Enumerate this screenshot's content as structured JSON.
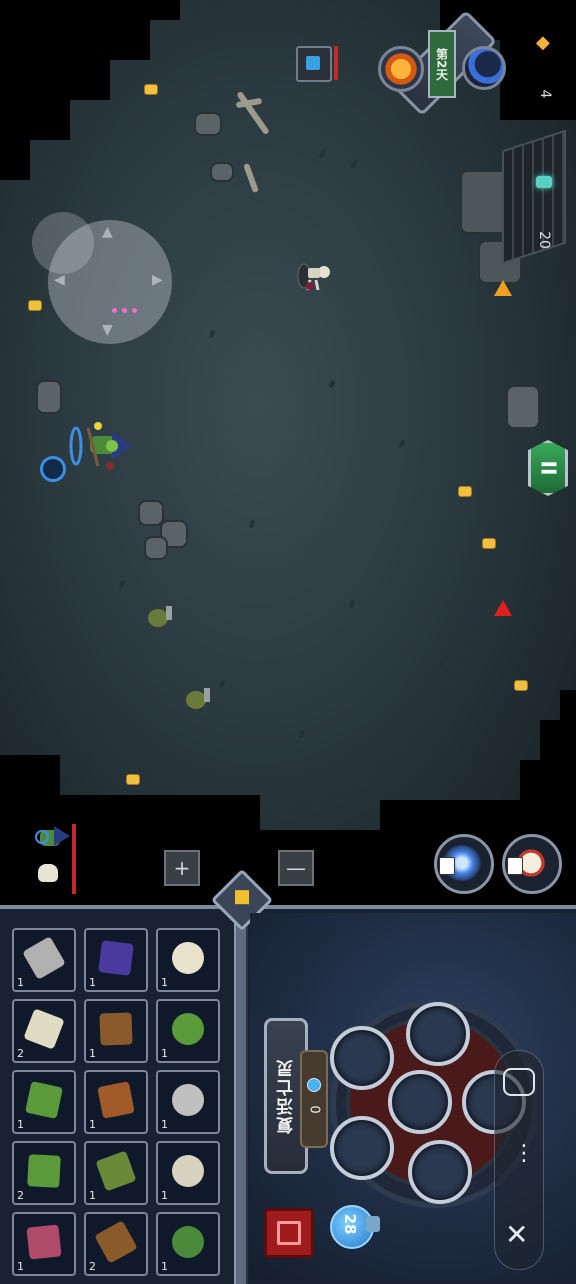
{
  "hud": {
    "day_label": "第2天",
    "gold_count": "4",
    "enemy_count": "20"
  },
  "icons": {
    "sun": "sun-icon",
    "moon": "moon-icon",
    "gold": "coin-icon",
    "pause": "pause-icon",
    "lightning": "lightning-skill-icon",
    "summon": "summon-skill-icon",
    "close": "close-icon",
    "more": "more-vertical-icon"
  },
  "controls": {
    "plus_label": "+",
    "minus_label": "—",
    "pause_label": "II"
  },
  "inventory": [
    {
      "name": "dagger",
      "count": "1"
    },
    {
      "name": "skeleton-body",
      "count": "1"
    },
    {
      "name": "skull",
      "count": "1"
    },
    {
      "name": "bone",
      "count": "2"
    },
    {
      "name": "bow-arms",
      "count": "1"
    },
    {
      "name": "zombie-head",
      "count": "1"
    },
    {
      "name": "zombie-leg",
      "count": "1"
    },
    {
      "name": "crossbow-arm",
      "count": "1"
    },
    {
      "name": "armored-skull",
      "count": "1"
    },
    {
      "name": "zombie-leg-green",
      "count": "2"
    },
    {
      "name": "green-bow-arm",
      "count": "1"
    },
    {
      "name": "ribcage",
      "count": "1"
    },
    {
      "name": "zombie-leg-red",
      "count": "1"
    },
    {
      "name": "staff-arm",
      "count": "2"
    },
    {
      "name": "zombie-torso",
      "count": "1"
    }
  ],
  "revive": {
    "label": "复活亡灵",
    "soul_count": "0",
    "mana": "28"
  },
  "colors": {
    "accent_green": "#2f6a3c",
    "hp_red": "#c62828",
    "mana_blue": "#2a78d0",
    "gold": "#f0c040"
  }
}
